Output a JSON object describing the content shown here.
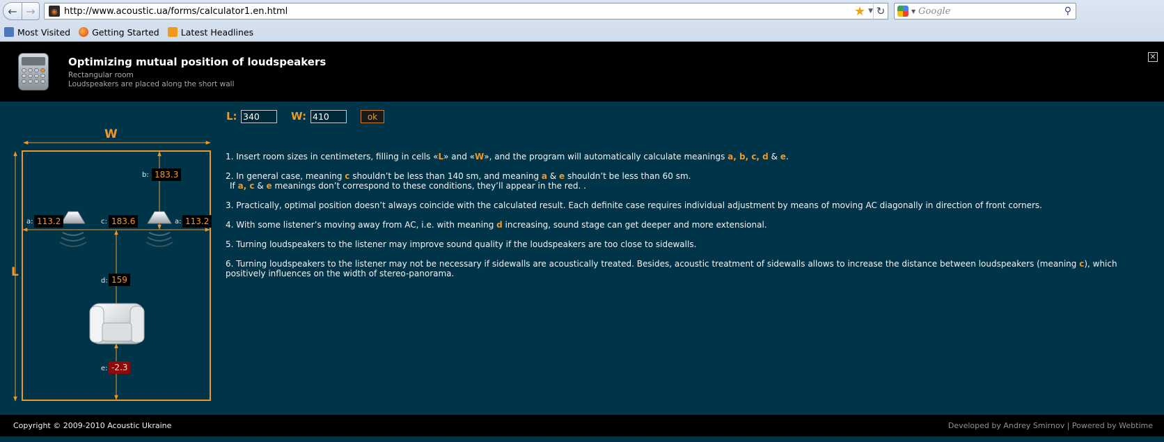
{
  "browser": {
    "url": "http://www.acoustic.ua/forms/calculator1.en.html",
    "search_placeholder": "Google",
    "bookmarks": [
      "Most Visited",
      "Getting Started",
      "Latest Headlines"
    ]
  },
  "header": {
    "title": "Optimizing mutual position of loudspeakers",
    "subtitle1": "Rectangular room",
    "subtitle2": "Loudspeakers are placed along the short wall"
  },
  "form": {
    "L_label": "L:",
    "L_value": "340",
    "W_label": "W:",
    "W_value": "410",
    "ok_label": "ok"
  },
  "diagram": {
    "W_label": "W",
    "L_label": "L",
    "a_label": "a:",
    "a_value": "113.2",
    "b_label": "b:",
    "b_value": "183.3",
    "c_label": "c:",
    "c_value": "183.6",
    "d_label": "d:",
    "d_value": "159",
    "e_label": "e:",
    "e_value": "-2.3",
    "accent_color": "#f0972a",
    "error_color": "#8b0b0b"
  },
  "instructions": {
    "p1": {
      "pre": "1. Insert room sizes in centimeters, filling in cells «",
      "L": "L",
      "mid": "» and «",
      "W": "W",
      "post": "», and the program will automatically calculate meanings ",
      "vals": "a, b, c, d",
      "amp": " & ",
      "e": "e",
      "end": "."
    },
    "p2": {
      "pre": "2. In general case, meaning ",
      "c": "c",
      "mid": " shouldn’t be less than 140 sm, and meaning ",
      "a": "a",
      "amp": " & ",
      "e": "e",
      "post": " shouldn’t be less than 60 sm."
    },
    "p2b": {
      "pre": "If ",
      "ac": "a, c",
      "amp": " & ",
      "e": "e",
      "post": " meanings don’t correspond to these conditions, they’ll appear in the red. ."
    },
    "p3": "3. Practically, optimal position doesn’t always coincide with the calculated result. Each definite case requires individual adjustment by means of moving AC diagonally in direction of front corners.",
    "p4": {
      "pre": "4. With some listener’s moving away from AC, i.e. with meaning ",
      "d": "d",
      "post": " increasing, sound stage can get deeper and more extensional."
    },
    "p5": "5. Turning loudspeakers to the listener may improve sound quality if the loudspeakers are too close to sidewalls.",
    "p6": {
      "pre": "6. Turning loudspeakers to the listener may not be necessary if sidewalls are acoustically treated. Besides, acoustic treatment of sidewalls allows to increase the distance between loudspeakers (meaning ",
      "c": "c",
      "post": "), which positively influences on the width of stereo-panorama."
    }
  },
  "footer": {
    "copyright": "Copyright © 2009-2010 Acoustic Ukraine",
    "credits": "Developed by Andrey Smirnov | Powered by Webtime"
  }
}
